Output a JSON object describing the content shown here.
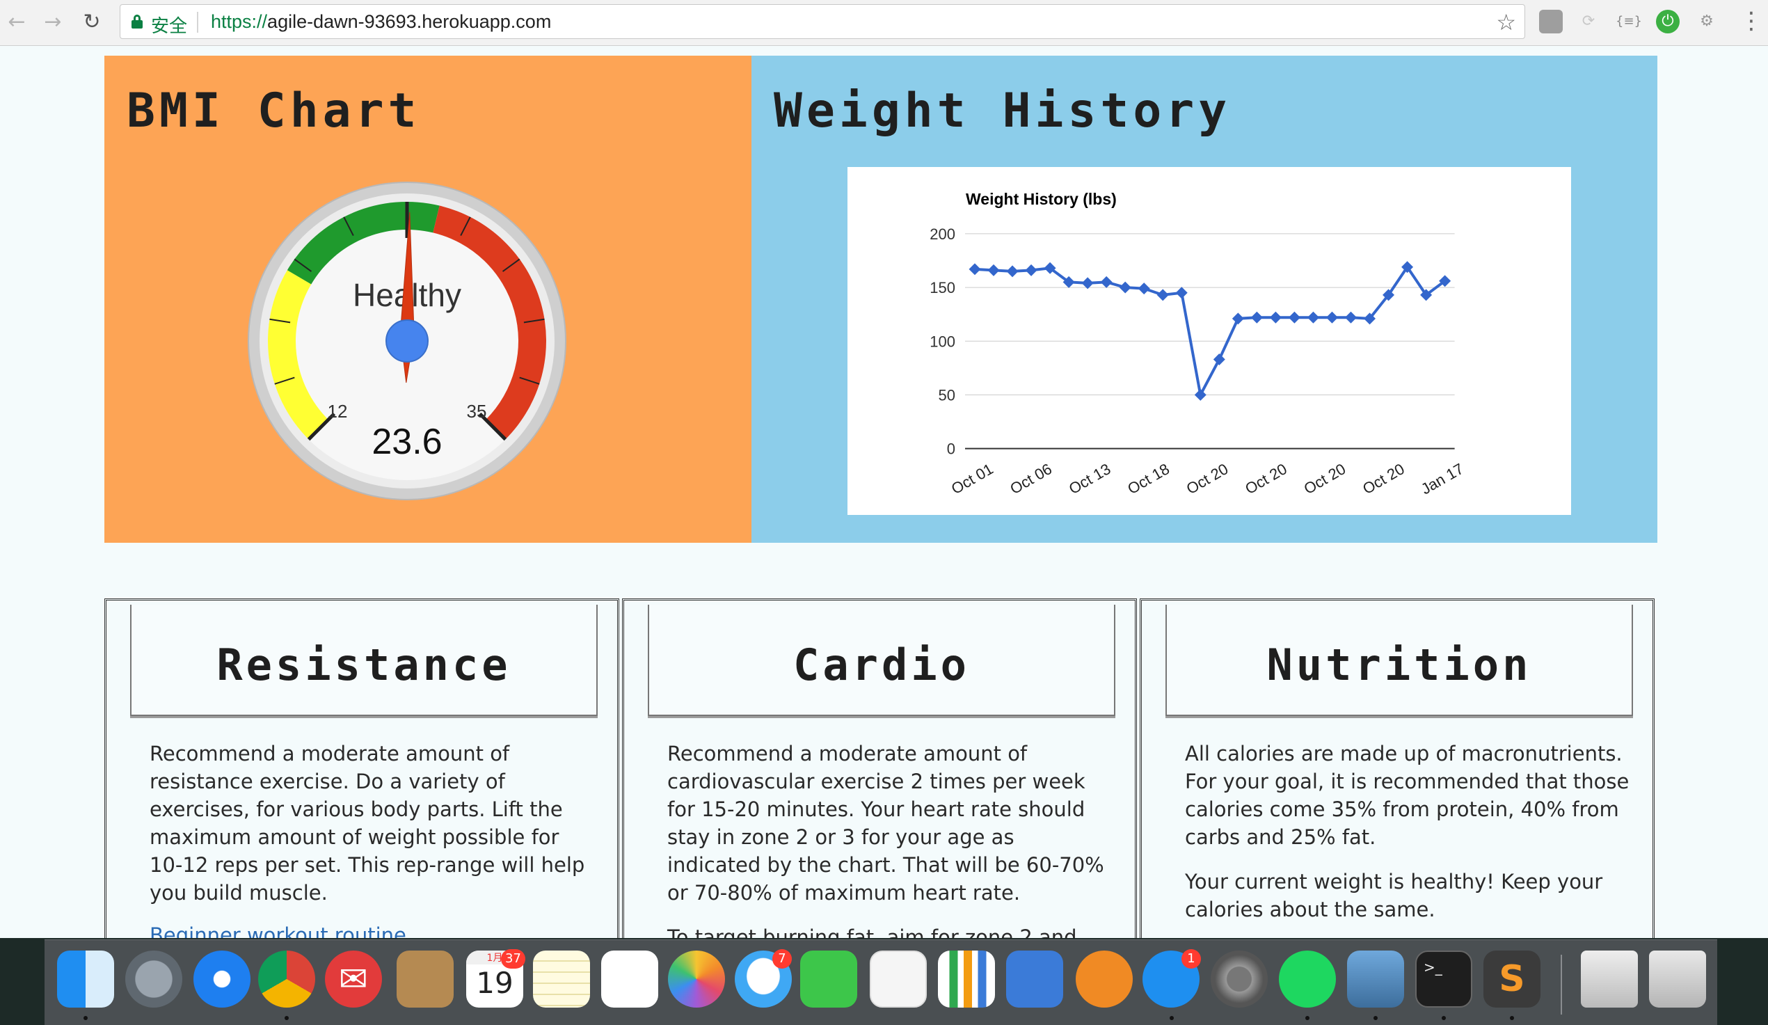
{
  "browser": {
    "secure_label": "安全",
    "url_scheme": "https://",
    "url_host": "agile-dawn-93693.herokuapp.com",
    "extensions": [
      "extension-icon-1",
      "extension-icon-2",
      "json-viewer-icon",
      "green-extension-icon",
      "settings-extension-icon"
    ]
  },
  "bmi_panel": {
    "title": "BMI Chart",
    "gauge": {
      "status_label": "Healthy",
      "value": 23.6,
      "value_text": "23.6",
      "min_label": "12",
      "max_label": "35",
      "min": 12,
      "max": 35,
      "colors": {
        "yellow": "#ffff33",
        "green": "#1f9a2d",
        "red": "#dd3b1e"
      }
    }
  },
  "weight_panel": {
    "title": "Weight History"
  },
  "chart_data": {
    "type": "line",
    "title": "Weight History (lbs)",
    "xlabel": "",
    "ylabel": "",
    "ylim": [
      0,
      200
    ],
    "yticks": [
      "200",
      "150",
      "100",
      "50",
      "0"
    ],
    "xtick_labels": [
      "Oct 01",
      "Oct 06",
      "Oct 13",
      "Oct 18",
      "Oct 20",
      "Oct 20",
      "Oct 20",
      "Oct 20",
      "Jan 17"
    ],
    "series": [
      {
        "color": "#3366cc",
        "values": [
          167,
          166,
          165,
          166,
          168,
          155,
          154,
          155,
          150,
          149,
          143,
          145,
          50,
          83,
          121,
          122,
          122,
          122,
          122,
          122,
          122,
          121,
          143,
          169,
          143,
          156
        ]
      }
    ],
    "grid": true
  },
  "cards": [
    {
      "title": "Resistance",
      "paragraphs": [
        "Recommend a moderate amount of resistance exercise. Do a variety of exercises, for various body parts. Lift the maximum amount of weight possible for 10-12 reps per set. This rep-range will help you build muscle."
      ],
      "link": "Beginner workout routine"
    },
    {
      "title": "Cardio",
      "paragraphs": [
        "Recommend a moderate amount of cardiovascular exercise 2 times per week for 15-20 minutes. Your heart rate should stay in zone 2 or 3 for your age as indicated by the chart. That will be 60-70% or 70-80% of maximum heart rate.",
        "To target burning fat, aim for zone 2 and"
      ]
    },
    {
      "title": "Nutrition",
      "paragraphs": [
        "All calories are made up of macronutrients. For your goal, it is recommended that those calories come 35% from protein, 40% from carbs and 25% fat.",
        "Your current weight is healthy! Keep your calories about the same."
      ]
    }
  ],
  "dock": {
    "calendar_month": "1月",
    "calendar_day": "19",
    "calendar_badge": "37",
    "messages_badge": "7",
    "appstore_badge": "1",
    "apps": [
      "finder",
      "launchpad",
      "safari",
      "chrome",
      "airmail",
      "contacts",
      "calendar",
      "notes",
      "reminders",
      "photos",
      "messages",
      "facetime",
      "pages",
      "numbers",
      "keynote",
      "ibooks",
      "app-store",
      "system-preferences",
      "spotify",
      "preview",
      "terminal",
      "sublime-text",
      "downloads",
      "trash"
    ]
  }
}
